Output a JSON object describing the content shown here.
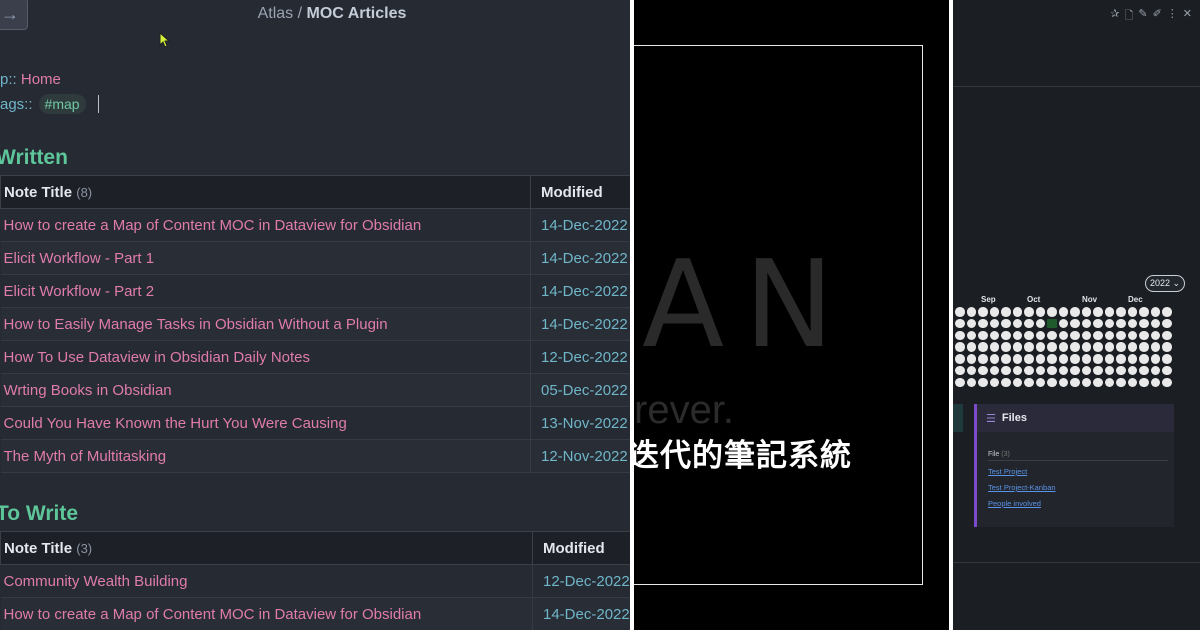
{
  "left": {
    "breadcrumb": {
      "parent": "Atlas",
      "sep": " / ",
      "current": "MOC Articles"
    },
    "back_icon": "arrow-right-icon",
    "props": {
      "up_key": "p::",
      "up_value": "Home",
      "tags_key": "ags::",
      "tag": "#map"
    },
    "written": {
      "heading": "Written",
      "col_title": "Note Title",
      "col_count": "(8)",
      "col_modified": "Modified",
      "rows": [
        {
          "title": "How to create a Map of Content MOC in Dataview for Obsidian",
          "date": "14-Dec-2022"
        },
        {
          "title": "Elicit Workflow - Part 1",
          "date": "14-Dec-2022"
        },
        {
          "title": "Elicit Workflow - Part 2",
          "date": "14-Dec-2022"
        },
        {
          "title": "How to Easily Manage Tasks in Obsidian Without a Plugin",
          "date": "14-Dec-2022"
        },
        {
          "title": "How To Use Dataview in Obsidian Daily Notes",
          "date": "12-Dec-2022"
        },
        {
          "title": "Wrting Books in Obsidian",
          "date": "05-Dec-2022"
        },
        {
          "title": "Could You Have Known the Hurt You Were Causing",
          "date": "13-Nov-2022"
        },
        {
          "title": "The Myth of Multitasking",
          "date": "12-Nov-2022"
        }
      ]
    },
    "towrite": {
      "heading": "To Write",
      "col_title": "Note Title",
      "col_count": "(3)",
      "col_modified": "Modified",
      "rows": [
        {
          "title": "Community Wealth Building",
          "date": "12-Dec-2022"
        },
        {
          "title": "How to create a Map of Content MOC in Dataview for Obsidian",
          "date": "14-Dec-2022"
        }
      ]
    }
  },
  "middle": {
    "big_text": "AN",
    "sub_text": "rever.",
    "caption": "迭代的筆記系統"
  },
  "right": {
    "toolbar_icons": [
      "pin-icon",
      "new-file-icon",
      "edit-icon",
      "pencil-icon",
      "more-icon",
      "close-icon"
    ],
    "year_select": "2022",
    "months": [
      "Sep",
      "Oct",
      "Nov",
      "Dec"
    ],
    "heatmap": {
      "highlight_week": 8,
      "highlight_day": 1
    },
    "files": {
      "title": "Files",
      "col": "File",
      "col_count": "(3)",
      "links": [
        "Test Project",
        "Test Project-Kanban",
        "People involved"
      ]
    }
  }
}
